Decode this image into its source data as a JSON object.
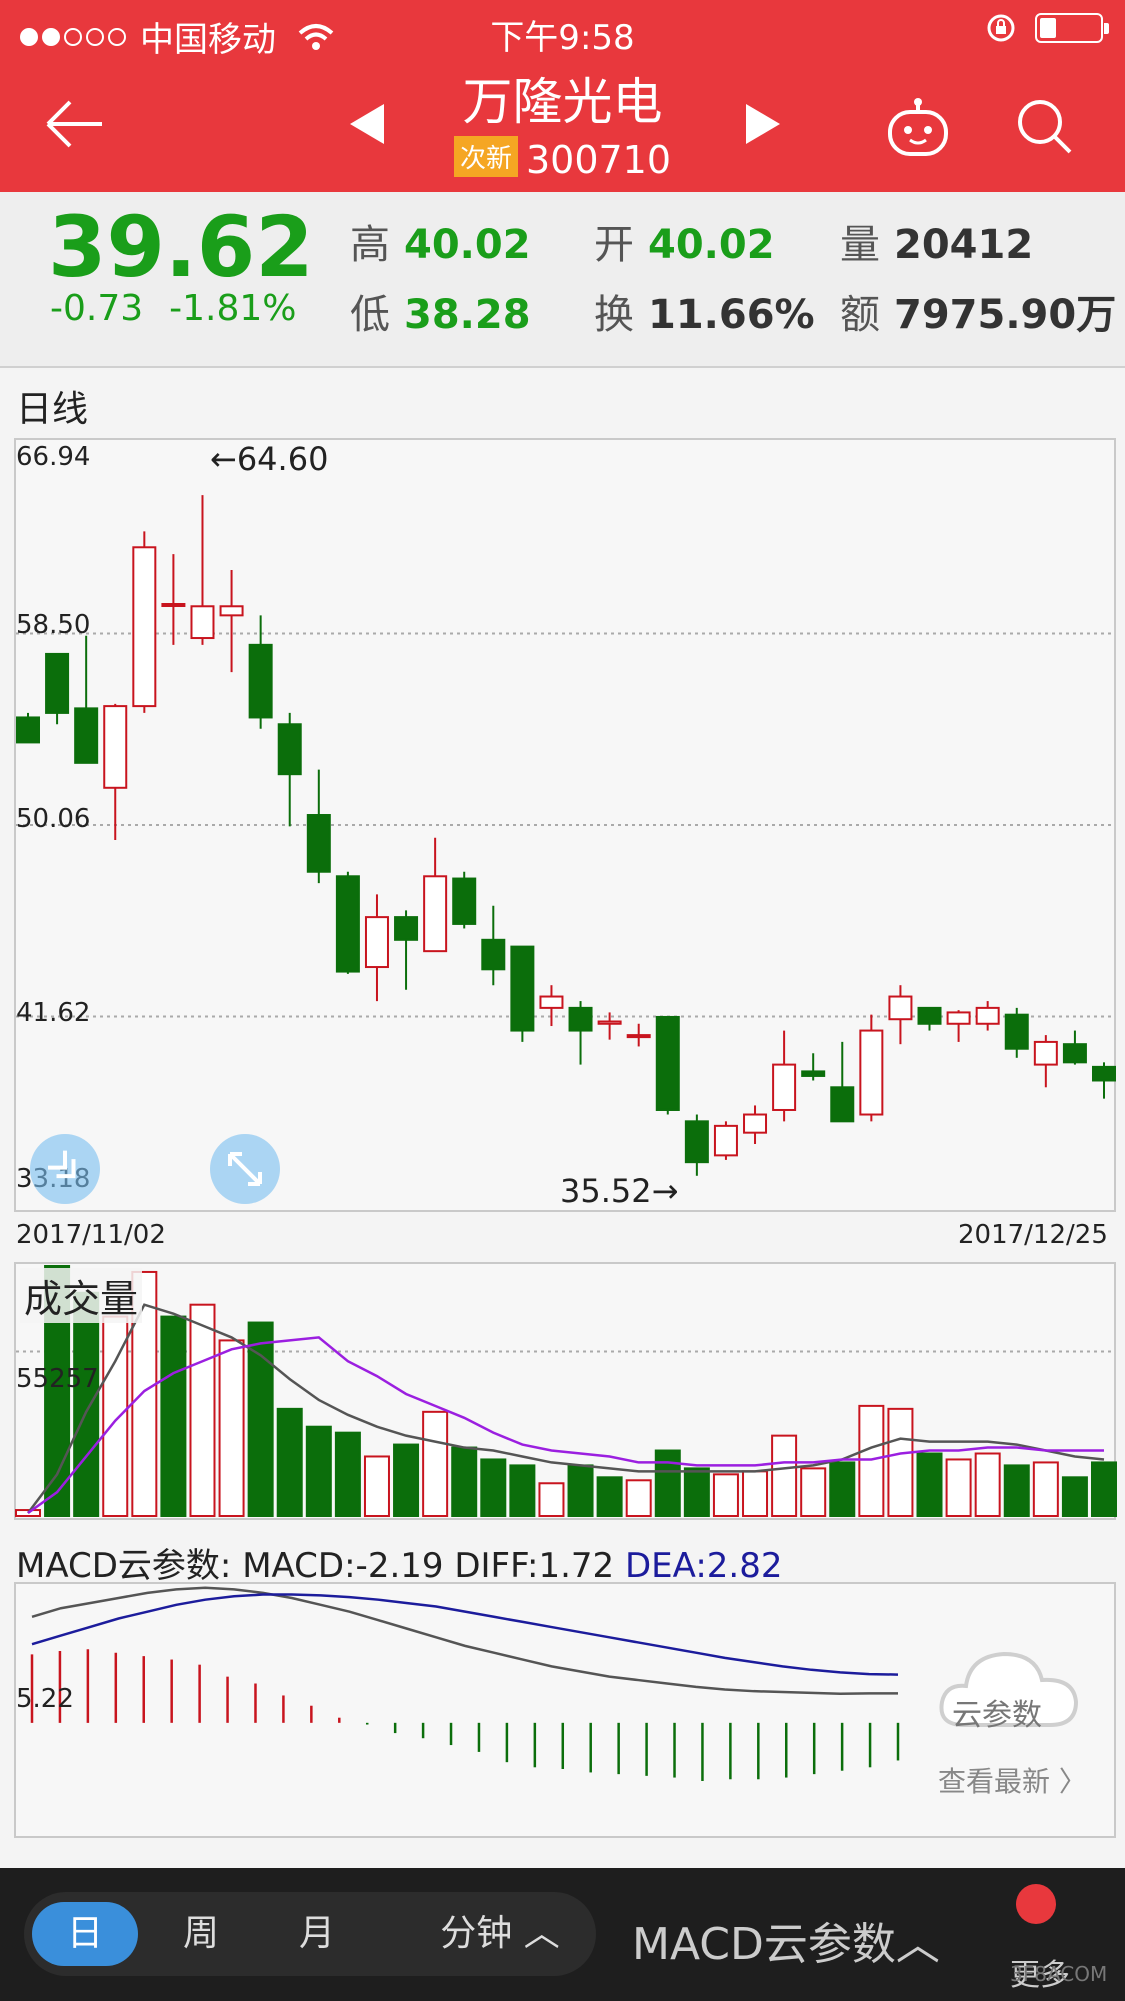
{
  "status_bar": {
    "carrier": "中国移动",
    "time": "下午9:58"
  },
  "nav": {
    "stock_name": "万隆光电",
    "badge": "次新",
    "stock_code": "300710"
  },
  "quote": {
    "price": "39.62",
    "change": "-0.73",
    "change_pct": "-1.81%",
    "high_label": "高",
    "high": "40.02",
    "low_label": "低",
    "low": "38.28",
    "open_label": "开",
    "open": "40.02",
    "turnover_label": "换",
    "turnover": "11.66%",
    "volume_label": "量",
    "volume": "20412",
    "amount_label": "额",
    "amount": "7975.90万"
  },
  "kline": {
    "title": "日线",
    "y_labels": [
      "66.94",
      "58.50",
      "50.06",
      "41.62",
      "33.18"
    ],
    "max_annot": "←64.60",
    "min_annot": "35.52→",
    "start_date": "2017/11/02",
    "end_date": "2017/12/25"
  },
  "volume": {
    "title": "成交量",
    "y_label": "55257"
  },
  "macd": {
    "title": "MACD云参数:",
    "macd": "MACD:-2.19",
    "diff": "DIFF:1.72",
    "dea": "DEA:2.82",
    "y_label": "5.22",
    "cloud_label": "云参数",
    "cloud_more": "查看最新 〉"
  },
  "bottom": {
    "day": "日",
    "week": "周",
    "month": "月",
    "minute": "分钟 ︿",
    "macd_tab": "MACD云参数︿",
    "more": "更多",
    "watermark": "3F8ACOM"
  },
  "colors": {
    "up": "#c8141e",
    "down": "#0b6e0b",
    "ma_dark": "#555555",
    "ma_purple": "#9b1fe0",
    "dea_blue": "#1c1c9c"
  },
  "chart_data": [
    {
      "type": "candlestick",
      "title": "日线",
      "x_range": [
        "2017/11/02",
        "2017/12/25"
      ],
      "ylim": [
        33.18,
        66.94
      ],
      "candles": [
        {
          "o": 54.8,
          "h": 55.0,
          "l": 53.7,
          "c": 53.7
        },
        {
          "o": 57.6,
          "h": 57.6,
          "l": 54.5,
          "c": 55.0
        },
        {
          "o": 55.2,
          "h": 58.4,
          "l": 53.0,
          "c": 52.8
        },
        {
          "o": 51.7,
          "h": 55.4,
          "l": 49.4,
          "c": 55.3
        },
        {
          "o": 55.3,
          "h": 63.0,
          "l": 55.0,
          "c": 62.3
        },
        {
          "o": 59.8,
          "h": 62.0,
          "l": 58.0,
          "c": 59.8
        },
        {
          "o": 58.3,
          "h": 64.6,
          "l": 58.0,
          "c": 59.7
        },
        {
          "o": 59.3,
          "h": 61.3,
          "l": 56.8,
          "c": 59.7
        },
        {
          "o": 58.0,
          "h": 59.3,
          "l": 54.3,
          "c": 54.8
        },
        {
          "o": 54.5,
          "h": 55.0,
          "l": 50.0,
          "c": 52.3
        },
        {
          "o": 50.5,
          "h": 52.5,
          "l": 47.5,
          "c": 48.0
        },
        {
          "o": 47.8,
          "h": 48.0,
          "l": 43.5,
          "c": 43.6
        },
        {
          "o": 43.8,
          "h": 47.0,
          "l": 42.3,
          "c": 46.0
        },
        {
          "o": 46.0,
          "h": 46.3,
          "l": 42.8,
          "c": 45.0
        },
        {
          "o": 44.5,
          "h": 49.5,
          "l": 44.5,
          "c": 47.8
        },
        {
          "o": 47.7,
          "h": 48.0,
          "l": 45.5,
          "c": 45.7
        },
        {
          "o": 45.0,
          "h": 46.5,
          "l": 43.0,
          "c": 43.7
        },
        {
          "o": 44.7,
          "h": 44.7,
          "l": 40.5,
          "c": 41.0
        },
        {
          "o": 42.0,
          "h": 43.0,
          "l": 41.2,
          "c": 42.5
        },
        {
          "o": 42.0,
          "h": 42.3,
          "l": 39.5,
          "c": 41.0
        },
        {
          "o": 41.3,
          "h": 41.8,
          "l": 40.6,
          "c": 41.4
        },
        {
          "o": 40.8,
          "h": 41.3,
          "l": 40.3,
          "c": 40.8
        },
        {
          "o": 41.6,
          "h": 41.6,
          "l": 37.3,
          "c": 37.5
        },
        {
          "o": 37.0,
          "h": 37.3,
          "l": 34.6,
          "c": 35.2
        },
        {
          "o": 35.5,
          "h": 37.0,
          "l": 35.3,
          "c": 36.8
        },
        {
          "o": 36.5,
          "h": 37.7,
          "l": 36.0,
          "c": 37.3
        },
        {
          "o": 37.5,
          "h": 41.0,
          "l": 37.0,
          "c": 39.5
        },
        {
          "o": 39.2,
          "h": 40.0,
          "l": 38.8,
          "c": 39.0
        },
        {
          "o": 38.5,
          "h": 40.5,
          "l": 37.5,
          "c": 37.0
        },
        {
          "o": 37.3,
          "h": 41.7,
          "l": 37.0,
          "c": 41.0
        },
        {
          "o": 41.5,
          "h": 43.0,
          "l": 40.4,
          "c": 42.5
        },
        {
          "o": 42.0,
          "h": 42.0,
          "l": 41.0,
          "c": 41.3
        },
        {
          "o": 41.3,
          "h": 41.9,
          "l": 40.5,
          "c": 41.8
        },
        {
          "o": 41.3,
          "h": 42.3,
          "l": 41.0,
          "c": 42.0
        },
        {
          "o": 41.7,
          "h": 42.0,
          "l": 39.8,
          "c": 40.2
        },
        {
          "o": 39.5,
          "h": 40.8,
          "l": 38.5,
          "c": 40.5
        },
        {
          "o": 40.4,
          "h": 41.0,
          "l": 39.5,
          "c": 39.6
        },
        {
          "o": 39.4,
          "h": 39.6,
          "l": 38.0,
          "c": 38.8
        }
      ]
    },
    {
      "type": "bar",
      "title": "成交量",
      "y_label_value": 55257,
      "ylim": [
        0,
        84000
      ],
      "values": [
        2000,
        84000,
        75000,
        67000,
        82000,
        67000,
        71000,
        59000,
        65000,
        36000,
        30000,
        28000,
        20000,
        24000,
        35000,
        23000,
        19000,
        17000,
        11000,
        17000,
        13000,
        12000,
        22000,
        16000,
        14000,
        15000,
        27000,
        16000,
        18000,
        37000,
        36000,
        21000,
        19000,
        21000,
        17000,
        18000,
        13000,
        18000
      ],
      "up": [
        true,
        false,
        false,
        true,
        true,
        false,
        true,
        true,
        false,
        false,
        false,
        false,
        true,
        false,
        true,
        false,
        false,
        false,
        true,
        false,
        false,
        true,
        false,
        false,
        true,
        true,
        true,
        true,
        false,
        true,
        true,
        false,
        true,
        true,
        false,
        true,
        false,
        false
      ],
      "ma_dark": [
        1000,
        14000,
        35000,
        52000,
        71000,
        68000,
        64000,
        60000,
        54000,
        46000,
        39000,
        34000,
        30000,
        27000,
        25000,
        23000,
        22000,
        20000,
        18000,
        17000,
        16000,
        15000,
        15000,
        15000,
        15000,
        15000,
        16000,
        17000,
        19000,
        23000,
        26000,
        25000,
        25000,
        25000,
        24000,
        22000,
        20000,
        19000
      ],
      "ma_purple": [
        1000,
        8000,
        20000,
        32000,
        42000,
        48000,
        52000,
        56000,
        58000,
        59000,
        60000,
        52000,
        47000,
        41000,
        37000,
        33000,
        28000,
        24000,
        22000,
        21000,
        20000,
        18000,
        18000,
        17000,
        17000,
        17000,
        18000,
        18000,
        19000,
        19000,
        21000,
        22000,
        22000,
        23000,
        23000,
        22000,
        22000,
        22000
      ]
    },
    {
      "type": "macd",
      "title": "MACD云参数:",
      "macd": -2.19,
      "diff": 1.72,
      "dea": 2.82,
      "ylim": [
        -6.5,
        8.0
      ],
      "hist": [
        4.0,
        4.2,
        4.3,
        4.1,
        3.9,
        3.7,
        3.4,
        2.7,
        2.3,
        1.6,
        1.0,
        0.3,
        -0.1,
        -0.6,
        -0.9,
        -1.3,
        -1.7,
        -2.3,
        -2.6,
        -2.7,
        -2.9,
        -3.0,
        -3.1,
        -3.2,
        -3.4,
        -3.3,
        -3.3,
        -3.2,
        -3.0,
        -2.8,
        -2.6,
        -2.2
      ],
      "diff_line": [
        6.2,
        6.7,
        7.0,
        7.3,
        7.6,
        7.8,
        7.9,
        7.8,
        7.6,
        7.3,
        6.9,
        6.5,
        6.0,
        5.5,
        5.0,
        4.5,
        4.1,
        3.7,
        3.3,
        3.0,
        2.7,
        2.5,
        2.3,
        2.1,
        1.95,
        1.85,
        1.8,
        1.75,
        1.7,
        1.72,
        1.72
      ],
      "dea_line": [
        4.6,
        5.1,
        5.6,
        6.1,
        6.5,
        6.9,
        7.2,
        7.4,
        7.5,
        7.5,
        7.45,
        7.35,
        7.2,
        7.0,
        6.8,
        6.5,
        6.2,
        5.9,
        5.6,
        5.3,
        5.0,
        4.7,
        4.4,
        4.1,
        3.8,
        3.55,
        3.3,
        3.1,
        2.95,
        2.85,
        2.82
      ]
    }
  ]
}
